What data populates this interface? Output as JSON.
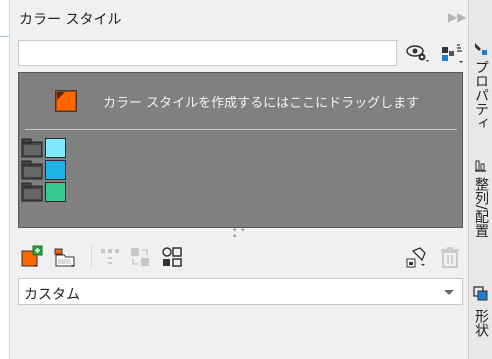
{
  "panel": {
    "title": "カラー スタイル",
    "collapse_icon": "double-chevron-right-icon",
    "close_icon": "close-icon"
  },
  "search": {
    "value": "",
    "placeholder": ""
  },
  "viewer": {
    "drop_hint": "カラー スタイルを作成するにはここにドラッグします",
    "drop_swatch_color": "#ff6600",
    "harmony_swatches": [
      "#7fe8ff",
      "#1fb4e8",
      "#38c88e"
    ]
  },
  "toolbar": {
    "items": [
      {
        "icon": "new-color-style-icon"
      },
      {
        "icon": "new-harmony-icon"
      },
      {
        "icon": "distribute-icon"
      },
      {
        "icon": "apply-icon"
      },
      {
        "icon": "auto-create-icon"
      },
      {
        "icon": "convert-icon"
      },
      {
        "icon": "trash-icon"
      }
    ]
  },
  "dropdown": {
    "selected": "カスタム",
    "icon": "chevron-down-icon"
  },
  "side_tabs": [
    {
      "label": "プロパティ",
      "icon": "properties-icon"
    },
    {
      "label": "整列/配置",
      "icon": "align-icon"
    },
    {
      "label": "形状",
      "icon": "shape-icon"
    }
  ],
  "colors": {
    "panel_bg": "#f0f0f0",
    "viewer_bg": "#808080",
    "accent_orange": "#ff6600"
  }
}
